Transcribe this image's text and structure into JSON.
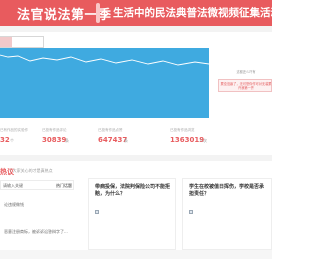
{
  "banner": {
    "title": "法官说法第一季",
    "campaign": "生活中的民法典普法微视频征集活动"
  },
  "map_panel": {
    "label": "这都还么吓有",
    "card_text": "累没没赢了，无可恐你作可对无装累许我第一齐"
  },
  "stats": [
    {
      "label": "已有作品的实验作",
      "value": "32",
      "unit": "个"
    },
    {
      "label": "已投有作品评论",
      "value": "30839",
      "unit": "条"
    },
    {
      "label": "已投有作品点赞",
      "value": "647437",
      "unit": "条"
    },
    {
      "label": "已投有作品浏览",
      "value": "1363019",
      "unit": "人次"
    }
  ],
  "section": {
    "title": "热议",
    "subtitle": "/ 大家关心的才是真热点"
  },
  "left_list": {
    "header": "请输入关键",
    "tab": "热门话题",
    "items": [
      "论违规做钱",
      "恶意注册商标，被诉诉讼答辩字了..."
    ]
  },
  "cards": [
    {
      "title": "带病投保，法院判保险公司不能拒赔，为什么？"
    },
    {
      "title": "学生在校被值日挥伤，学校是否承担责任？"
    }
  ],
  "colors": {
    "brand": "#e85b5e",
    "map": "#3faae0"
  }
}
